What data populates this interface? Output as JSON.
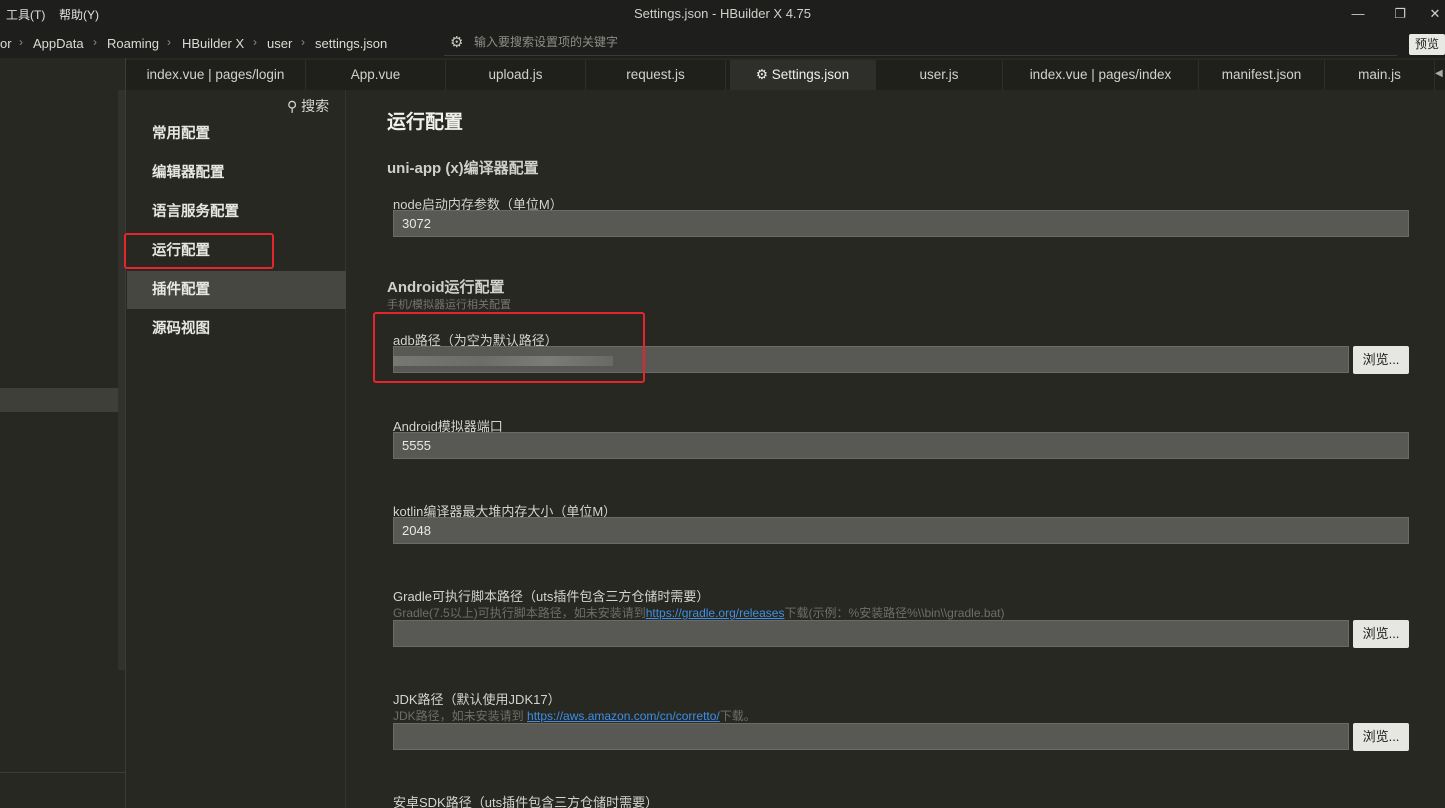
{
  "titlebar": {
    "menu_tools": "工具(T)",
    "menu_help": "帮助(Y)",
    "title": "Settings.json - HBuilder X 4.75",
    "min_icon": "minimize-icon",
    "max_icon": "maximize-icon",
    "close_icon": "close-icon"
  },
  "breadcrumb": {
    "items": [
      "or",
      "AppData",
      "Roaming",
      "HBuilder X",
      "user",
      "settings.json"
    ],
    "separator": "›"
  },
  "search": {
    "placeholder": "输入要搜索设置项的关键字"
  },
  "preview_label": "预览",
  "tabs": [
    {
      "label": "index.vue | pages/login"
    },
    {
      "label": "App.vue"
    },
    {
      "label": "upload.js"
    },
    {
      "label": "request.js"
    },
    {
      "label": "Settings.json",
      "active": true
    },
    {
      "label": "user.js"
    },
    {
      "label": "index.vue | pages/index"
    },
    {
      "label": "manifest.json"
    },
    {
      "label": "main.js"
    }
  ],
  "sidebar": {
    "search_label": "搜索",
    "items": [
      {
        "label": "常用配置"
      },
      {
        "label": "编辑器配置"
      },
      {
        "label": "语言服务配置"
      },
      {
        "label": "运行配置"
      },
      {
        "label": "插件配置",
        "active": true
      },
      {
        "label": "源码视图"
      }
    ]
  },
  "content": {
    "title": "运行配置",
    "section_uniapp": "uni-app (x)编译器配置",
    "node_mem": {
      "label": "node启动内存参数（单位M）",
      "value": "3072"
    },
    "section_android": "Android运行配置",
    "section_android_desc": "手机/模拟器运行相关配置",
    "adb_path": {
      "label": "adb路径（为空为默认路径）",
      "browse": "浏览..."
    },
    "emulator_port": {
      "label": "Android模拟器端口",
      "value": "5555"
    },
    "kotlin_heap": {
      "label": "kotlin编译器最大堆内存大小（单位M）",
      "value": "2048"
    },
    "gradle": {
      "label": "Gradle可执行脚本路径（uts插件包含三方仓储时需要）",
      "hint_pre": "Gradle(7.5以上)可执行脚本路径，如未安装请到",
      "hint_link": "https://gradle.org/releases",
      "hint_post": "下载(示例：%安装路径%\\\\bin\\\\gradle.bat)",
      "browse": "浏览..."
    },
    "jdk": {
      "label": "JDK路径（默认使用JDK17）",
      "hint_pre": "JDK路径，如未安装请到 ",
      "hint_link": "https://aws.amazon.com/cn/corretto/",
      "hint_post": "下载。",
      "browse": "浏览..."
    },
    "sdk": {
      "label": "安卓SDK路径（uts插件包含三方仓储时需要）"
    }
  },
  "colors": {
    "background": "#272822",
    "highlight_box": "#e4262c",
    "link": "#3f8fe3"
  }
}
